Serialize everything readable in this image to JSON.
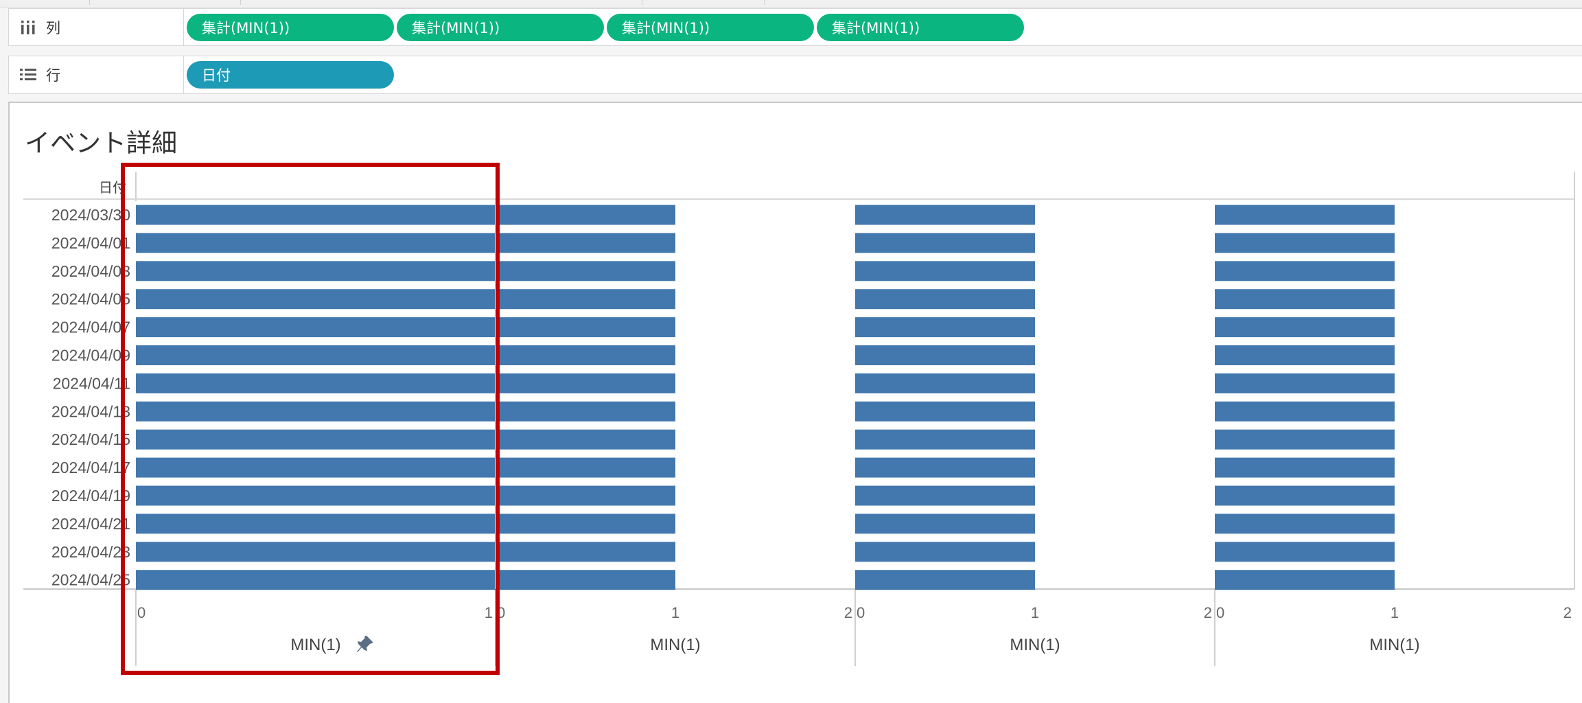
{
  "shelves": {
    "columns": {
      "label": "列",
      "icon": "columns-icon",
      "pills": [
        "集計(MIN(1))",
        "集計(MIN(1))",
        "集計(MIN(1))",
        "集計(MIN(1))"
      ]
    },
    "rows": {
      "label": "行",
      "icon": "rows-list-icon",
      "pills": [
        "日付"
      ]
    }
  },
  "sheet": {
    "title": "イベント詳細"
  },
  "colors": {
    "measure_pill": "#0bb57f",
    "dimension_pill": "#1d9ab6",
    "bar": "#4278ad",
    "highlight": "#c00000"
  },
  "chart_data": {
    "type": "bar",
    "row_header": "日付",
    "categories": [
      "2024/03/30",
      "2024/04/01",
      "2024/04/03",
      "2024/04/05",
      "2024/04/07",
      "2024/04/09",
      "2024/04/11",
      "2024/04/13",
      "2024/04/15",
      "2024/04/17",
      "2024/04/19",
      "2024/04/21",
      "2024/04/23",
      "2024/04/25"
    ],
    "panes": [
      {
        "xlabel": "MIN(1)",
        "pinned": true,
        "xlim": [
          0,
          1
        ],
        "ticks": [
          "0",
          "1"
        ],
        "values": [
          1,
          1,
          1,
          1,
          1,
          1,
          1,
          1,
          1,
          1,
          1,
          1,
          1,
          1
        ]
      },
      {
        "xlabel": "MIN(1)",
        "pinned": false,
        "xlim": [
          0,
          2
        ],
        "ticks": [
          "0",
          "1",
          "2"
        ],
        "values": [
          1,
          1,
          1,
          1,
          1,
          1,
          1,
          1,
          1,
          1,
          1,
          1,
          1,
          1
        ]
      },
      {
        "xlabel": "MIN(1)",
        "pinned": false,
        "xlim": [
          0,
          2
        ],
        "ticks": [
          "0",
          "1",
          "2"
        ],
        "values": [
          1,
          1,
          1,
          1,
          1,
          1,
          1,
          1,
          1,
          1,
          1,
          1,
          1,
          1
        ]
      },
      {
        "xlabel": "MIN(1)",
        "pinned": false,
        "xlim": [
          0,
          2
        ],
        "ticks": [
          "0",
          "1",
          "2"
        ],
        "values": [
          1,
          1,
          1,
          1,
          1,
          1,
          1,
          1,
          1,
          1,
          1,
          1,
          1,
          1
        ]
      }
    ]
  }
}
